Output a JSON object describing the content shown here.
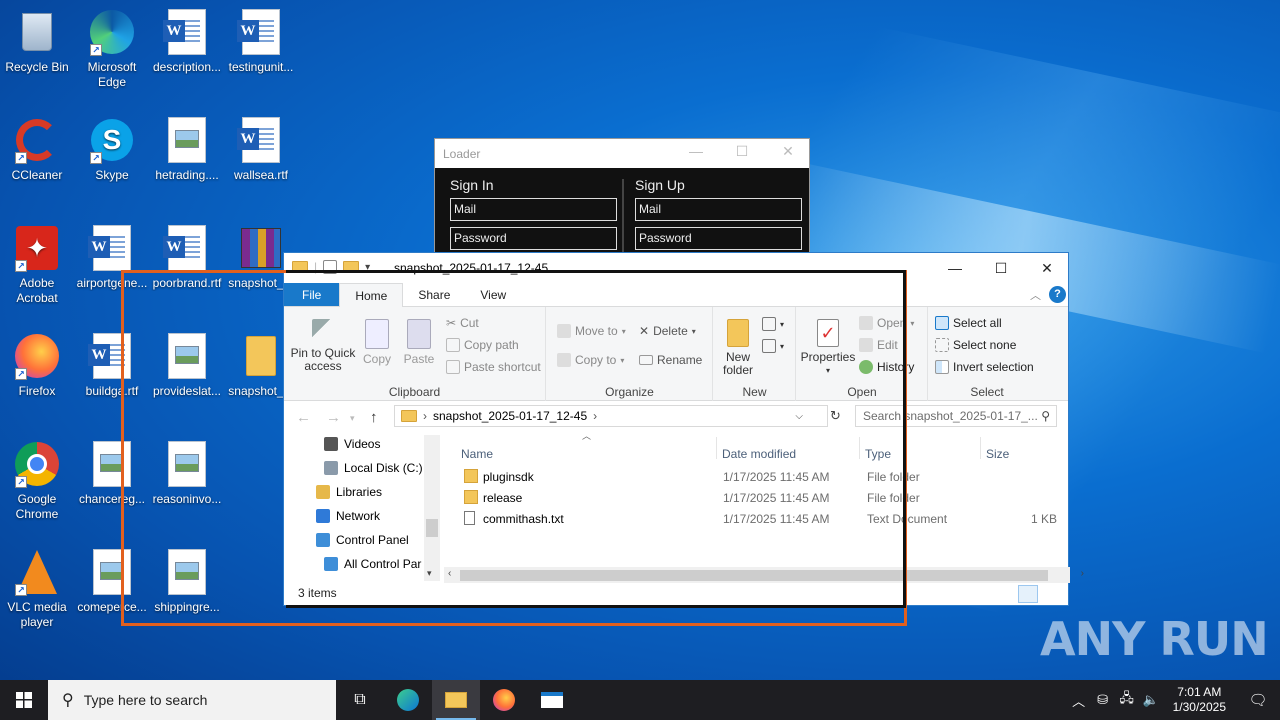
{
  "desktop": {
    "icons": [
      {
        "label": "Recycle Bin",
        "icon": "recycle-bin-icon"
      },
      {
        "label": "Microsoft Edge",
        "icon": "edge-icon"
      },
      {
        "label": "description...",
        "icon": "word-doc-icon"
      },
      {
        "label": "testingunit...",
        "icon": "word-doc-icon"
      },
      {
        "label": "CCleaner",
        "icon": "ccleaner-icon"
      },
      {
        "label": "Skype",
        "icon": "skype-icon"
      },
      {
        "label": "hetrading....",
        "icon": "image-file-icon"
      },
      {
        "label": "wallsea.rtf",
        "icon": "word-doc-icon"
      },
      {
        "label": "Adobe Acrobat",
        "icon": "acrobat-icon"
      },
      {
        "label": "airportgene...",
        "icon": "word-doc-icon"
      },
      {
        "label": "poorbrand.rtf",
        "icon": "word-doc-icon"
      },
      {
        "label": "snapshot_...",
        "icon": "winrar-icon"
      },
      {
        "label": "Firefox",
        "icon": "firefox-icon"
      },
      {
        "label": "buildga.rtf",
        "icon": "word-doc-icon"
      },
      {
        "label": "provideslat...",
        "icon": "image-file-icon"
      },
      {
        "label": "snapshot_...",
        "icon": "folder-icon"
      },
      {
        "label": "Google Chrome",
        "icon": "chrome-icon"
      },
      {
        "label": "chancereg...",
        "icon": "image-file-icon"
      },
      {
        "label": "reasoninvo...",
        "icon": "image-file-icon"
      },
      {
        "label": "VLC media player",
        "icon": "vlc-icon"
      },
      {
        "label": "comeperce...",
        "icon": "image-file-icon"
      },
      {
        "label": "shippingre...",
        "icon": "image-file-icon"
      }
    ]
  },
  "loader": {
    "title": "Loader",
    "signin": {
      "heading": "Sign In",
      "mail": "Mail",
      "password": "Password"
    },
    "signup": {
      "heading": "Sign Up",
      "mail": "Mail",
      "password": "Password"
    },
    "controls": {
      "minimize": "—",
      "maximize": "☐",
      "close": "✕"
    }
  },
  "explorer": {
    "title": "snapshot_2025-01-17_12-45",
    "controls": {
      "minimize": "—",
      "maximize": "☐",
      "close": "✕"
    },
    "tabs": [
      "File",
      "Home",
      "Share",
      "View"
    ],
    "help": "?",
    "ribbon": {
      "clipboard": {
        "label": "Clipboard",
        "pin": "Pin to Quick access",
        "copy": "Copy",
        "paste": "Paste",
        "cut": "Cut",
        "copy_path": "Copy path",
        "paste_shortcut": "Paste shortcut"
      },
      "organize": {
        "label": "Organize",
        "move_to": "Move to",
        "copy_to": "Copy to",
        "delete": "Delete",
        "rename": "Rename"
      },
      "new": {
        "label": "New",
        "new_folder": "New folder"
      },
      "open": {
        "label": "Open",
        "properties": "Properties",
        "open": "Open",
        "edit": "Edit",
        "history": "History"
      },
      "select": {
        "label": "Select",
        "select_all": "Select all",
        "select_none": "Select none",
        "invert": "Invert selection"
      }
    },
    "address": {
      "path": "snapshot_2025-01-17_12-45",
      "search_placeholder": "Search snapshot_2025-01-17_..."
    },
    "nav_pane": [
      {
        "label": "Videos",
        "icon": "videos-icon"
      },
      {
        "label": "Local Disk (C:)",
        "icon": "disk-icon"
      },
      {
        "label": "Libraries",
        "icon": "libraries-icon"
      },
      {
        "label": "Network",
        "icon": "network-icon"
      },
      {
        "label": "Control Panel",
        "icon": "control-panel-icon"
      },
      {
        "label": "All Control Par",
        "icon": "control-panel-icon"
      }
    ],
    "columns": {
      "name": "Name",
      "date": "Date modified",
      "type": "Type",
      "size": "Size"
    },
    "files": [
      {
        "name": "pluginsdk",
        "date": "1/17/2025 11:45 AM",
        "type": "File folder",
        "size": "",
        "icon": "folder-icon"
      },
      {
        "name": "release",
        "date": "1/17/2025 11:45 AM",
        "type": "File folder",
        "size": "",
        "icon": "folder-icon"
      },
      {
        "name": "commithash.txt",
        "date": "1/17/2025 11:45 AM",
        "type": "Text Document",
        "size": "1 KB",
        "icon": "text-file-icon"
      }
    ],
    "status": "3 items"
  },
  "watermark": "ANY RUN",
  "taskbar": {
    "search_placeholder": "Type here to search",
    "clock_time": "7:01 AM",
    "clock_date": "1/30/2025"
  },
  "colors": {
    "accent": "#1979ca",
    "annotation_orange": "#e2601e",
    "taskbar": "#1e1e22"
  }
}
